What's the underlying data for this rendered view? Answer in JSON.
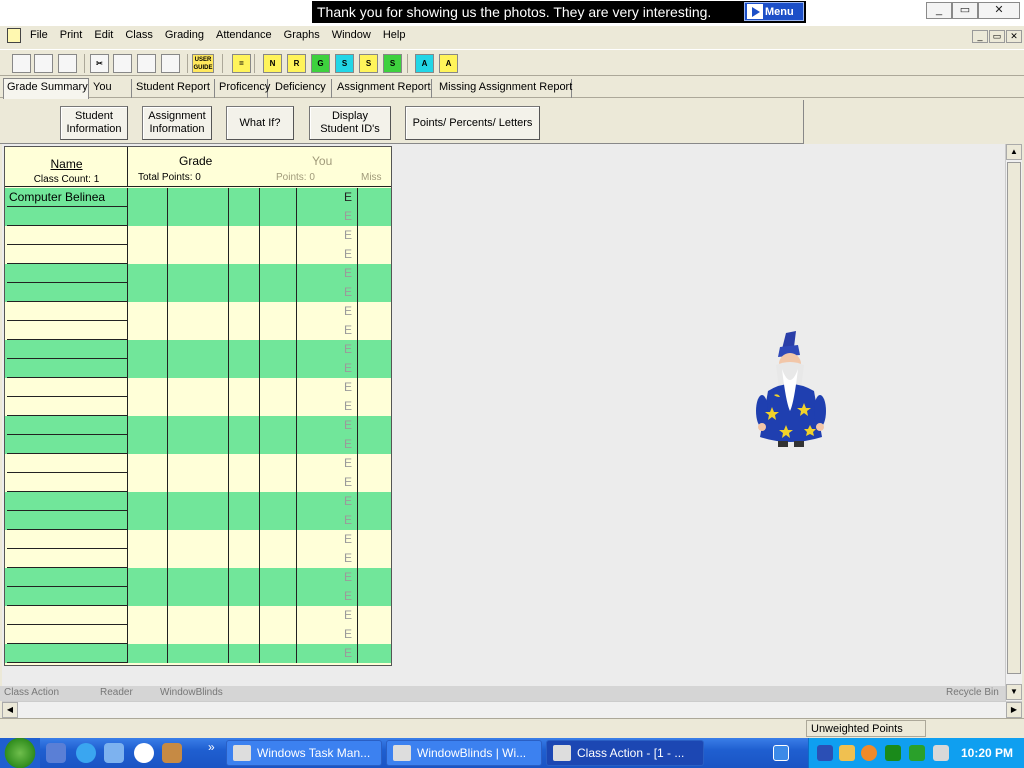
{
  "banner": {
    "text": "Thank you for showing us the photos. They are very interesting.",
    "menu_label": "Menu"
  },
  "window_controls": {
    "minimize": "_",
    "restore": "▭",
    "close": "✕"
  },
  "menubar": {
    "items": [
      "File",
      "Print",
      "Edit",
      "Class",
      "Grading",
      "Attendance",
      "Graphs",
      "Window",
      "Help"
    ]
  },
  "toolbar": {
    "buttons": [
      {
        "name": "new-file-icon",
        "glyph": ""
      },
      {
        "name": "open-folder-icon",
        "glyph": ""
      },
      {
        "name": "save-icon",
        "glyph": ""
      },
      {
        "name": "cut-icon",
        "glyph": "✂"
      },
      {
        "name": "copy-icon",
        "glyph": ""
      },
      {
        "name": "paste-icon",
        "glyph": ""
      },
      {
        "name": "gradebook-icon",
        "glyph": ""
      },
      {
        "name": "user-guide-icon",
        "glyph": "USER GUIDE"
      },
      {
        "name": "equal-icon",
        "glyph": "="
      },
      {
        "name": "sort-name-icon",
        "glyph": "N"
      },
      {
        "name": "sort-report-icon",
        "glyph": "R"
      },
      {
        "name": "sort-grade-icon",
        "glyph": "G"
      },
      {
        "name": "sort-s1-icon",
        "glyph": "S"
      },
      {
        "name": "sort-s2-icon",
        "glyph": "S"
      },
      {
        "name": "sort-s3-icon",
        "glyph": "S"
      },
      {
        "name": "add-a-icon",
        "glyph": "A"
      },
      {
        "name": "add-a2-icon",
        "glyph": "A"
      }
    ]
  },
  "tabs": [
    "Grade Summary",
    "You",
    "Student Report",
    "Proficency",
    "Deficiency",
    "Assignment Report",
    "Missing Assignment Report"
  ],
  "buttons": {
    "student_info": "Student Information",
    "assignment_info": "Assignment Information",
    "what_if": "What If?",
    "display_ids": "Display Student ID's",
    "points_percents": "Points/ Percents/ Letters"
  },
  "grid": {
    "name_header": "Name",
    "class_count": "Class Count: 1",
    "grade_header": "Grade",
    "total_points": "Total Points: 0",
    "you_header": "You",
    "you_points": "Points: 0",
    "miss_header": "Miss",
    "first_student": "Computer Belinea",
    "e_mark": "E",
    "row_count": 25
  },
  "background_labels": [
    "Class Action",
    "Reader",
    "WindowBlinds",
    "Recycle Bin"
  ],
  "status": {
    "text": "Unweighted Points"
  },
  "taskbar": {
    "tasks": [
      "Windows Task Man...",
      "WindowBlinds | Wi...",
      "Class Action - [1  -  ..."
    ],
    "clock": "10:20 PM",
    "chevron": "»"
  },
  "colors": {
    "row_green": "#71e69a",
    "row_yellow": "#ffffd8",
    "banner_bg": "#000000",
    "taskbar": "#1f5fd0"
  }
}
